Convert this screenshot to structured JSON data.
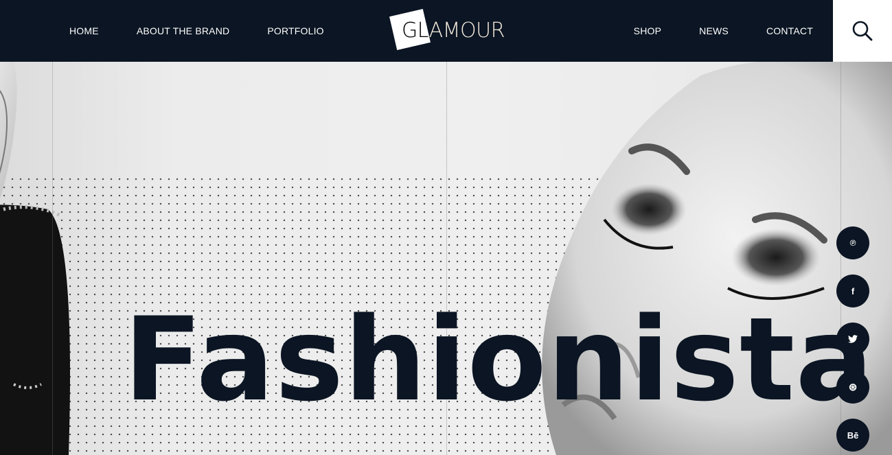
{
  "nav": {
    "left": [
      {
        "label": "HOME"
      },
      {
        "label": "ABOUT THE BRAND"
      },
      {
        "label": "PORTFOLIO"
      }
    ],
    "right": [
      {
        "label": "SHOP"
      },
      {
        "label": "NEWS"
      },
      {
        "label": "CONTACT"
      }
    ]
  },
  "brand": {
    "logo_text": "GLAMOUR"
  },
  "hero": {
    "title": "Fashionista"
  },
  "social": [
    {
      "name": "pinterest",
      "glyph": "℗"
    },
    {
      "name": "facebook",
      "glyph": "f"
    },
    {
      "name": "twitter",
      "glyph": "🐦"
    },
    {
      "name": "dribbble",
      "glyph": "⊛"
    },
    {
      "name": "behance",
      "glyph": "Bē"
    }
  ],
  "colors": {
    "navy": "#0b1523",
    "white": "#ffffff"
  }
}
